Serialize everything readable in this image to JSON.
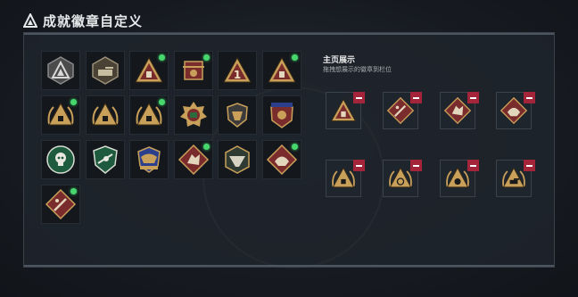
{
  "header": {
    "title": "成就徽章自定义",
    "logo_icon": "triangle-logo-icon"
  },
  "showcase": {
    "title": "主页展示",
    "subtitle": "拖拽想展示的徽章到栏位"
  },
  "colors": {
    "accent_gold": "#c9a05a",
    "badge_red": "#7a2b2c",
    "new_dot": "#46d86c",
    "remove_red": "#a4243a"
  },
  "badges": [
    {
      "icon": "triangle-badge-icon",
      "new": false
    },
    {
      "icon": "tank-badge-icon",
      "new": false
    },
    {
      "icon": "red-triangle-badge-icon",
      "new": true
    },
    {
      "icon": "crest-badge-icon",
      "new": true
    },
    {
      "icon": "number-one-badge-icon",
      "new": false
    },
    {
      "icon": "target-triangle-badge-icon",
      "new": true
    },
    {
      "icon": "laurel-triangle-badge-icon",
      "new": true
    },
    {
      "icon": "laurel-triangle-2-badge-icon",
      "new": false
    },
    {
      "icon": "laurel-triangle-3-badge-icon",
      "new": true
    },
    {
      "icon": "medal-badge-icon",
      "new": false
    },
    {
      "icon": "shield-badge-icon",
      "new": false
    },
    {
      "icon": "stars-shield-badge-icon",
      "new": false
    },
    {
      "icon": "green-skull-badge-icon",
      "new": false
    },
    {
      "icon": "green-shield-badge-icon",
      "new": false
    },
    {
      "icon": "eagle-crest-badge-icon",
      "new": false
    },
    {
      "icon": "diamond-wolf-badge-icon",
      "new": true
    },
    {
      "icon": "hexagon-eagle-badge-icon",
      "new": false
    },
    {
      "icon": "diamond-beast-badge-icon",
      "new": true
    },
    {
      "icon": "diamond-rifle-badge-icon",
      "new": true
    }
  ],
  "display_slots": [
    {
      "icon": "target-triangle-slot-icon"
    },
    {
      "icon": "diamond-rifle-slot-icon"
    },
    {
      "icon": "diamond-wolf-slot-icon"
    },
    {
      "icon": "diamond-beast-slot-icon"
    },
    {
      "icon": "laurel-triangle-slot-icon"
    },
    {
      "icon": "laurel-target-slot-icon"
    },
    {
      "icon": "laurel-skull-slot-icon"
    },
    {
      "icon": "laurel-tank-slot-icon"
    }
  ]
}
